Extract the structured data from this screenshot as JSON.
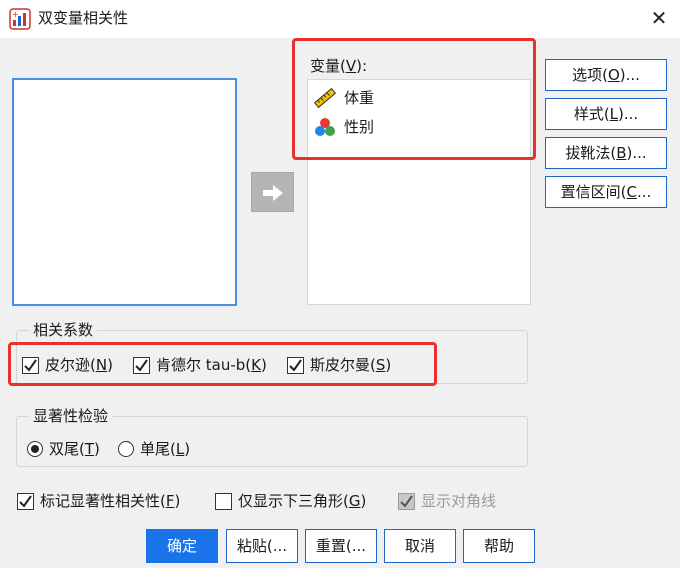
{
  "window": {
    "title": "双变量相关性",
    "close_label": "✕"
  },
  "variables": {
    "label_pre": "变量(",
    "label_key": "V",
    "label_post": "):",
    "items": [
      {
        "label": "体重",
        "icon": "ruler-scale-icon"
      },
      {
        "label": "性别",
        "icon": "nominal-balls-icon"
      }
    ]
  },
  "side_buttons": [
    {
      "pre": "选项(",
      "key": "O",
      "post": ")..."
    },
    {
      "pre": "样式(",
      "key": "L",
      "post": ")..."
    },
    {
      "pre": "拔靴法(",
      "key": "B",
      "post": ")..."
    },
    {
      "pre": "置信区间(",
      "key": "C",
      "post": "..."
    }
  ],
  "coefficients": {
    "legend": "相关系数",
    "options": [
      {
        "pre": "皮尔逊(",
        "key": "N",
        "post": ")",
        "checked": true
      },
      {
        "pre": "肯德尔 tau-b(",
        "key": "K",
        "post": ")",
        "checked": true
      },
      {
        "pre": "斯皮尔曼(",
        "key": "S",
        "post": ")",
        "checked": true
      }
    ]
  },
  "significance": {
    "legend": "显著性检验",
    "options": [
      {
        "pre": "双尾(",
        "key": "T",
        "post": ")",
        "selected": true
      },
      {
        "pre": "单尾(",
        "key": "L",
        "post": ")",
        "selected": false
      }
    ]
  },
  "bottom_options": [
    {
      "pre": "标记显著性相关性(",
      "key": "F",
      "post": ")",
      "checked": true,
      "enabled": true
    },
    {
      "pre": "仅显示下三角形(",
      "key": "G",
      "post": ")",
      "checked": false,
      "enabled": true
    },
    {
      "text": "显示对角线",
      "checked": true,
      "enabled": false
    }
  ],
  "footer_buttons": [
    {
      "label": "确定"
    },
    {
      "pre": "粘贴(",
      "post": "..."
    },
    {
      "pre": "重置(",
      "post": "..."
    },
    {
      "label": "取消"
    },
    {
      "label": "帮助"
    }
  ],
  "colors": {
    "accent": "#1a73e8",
    "highlight": "#e8312a",
    "list_border": "#4a90e2"
  }
}
